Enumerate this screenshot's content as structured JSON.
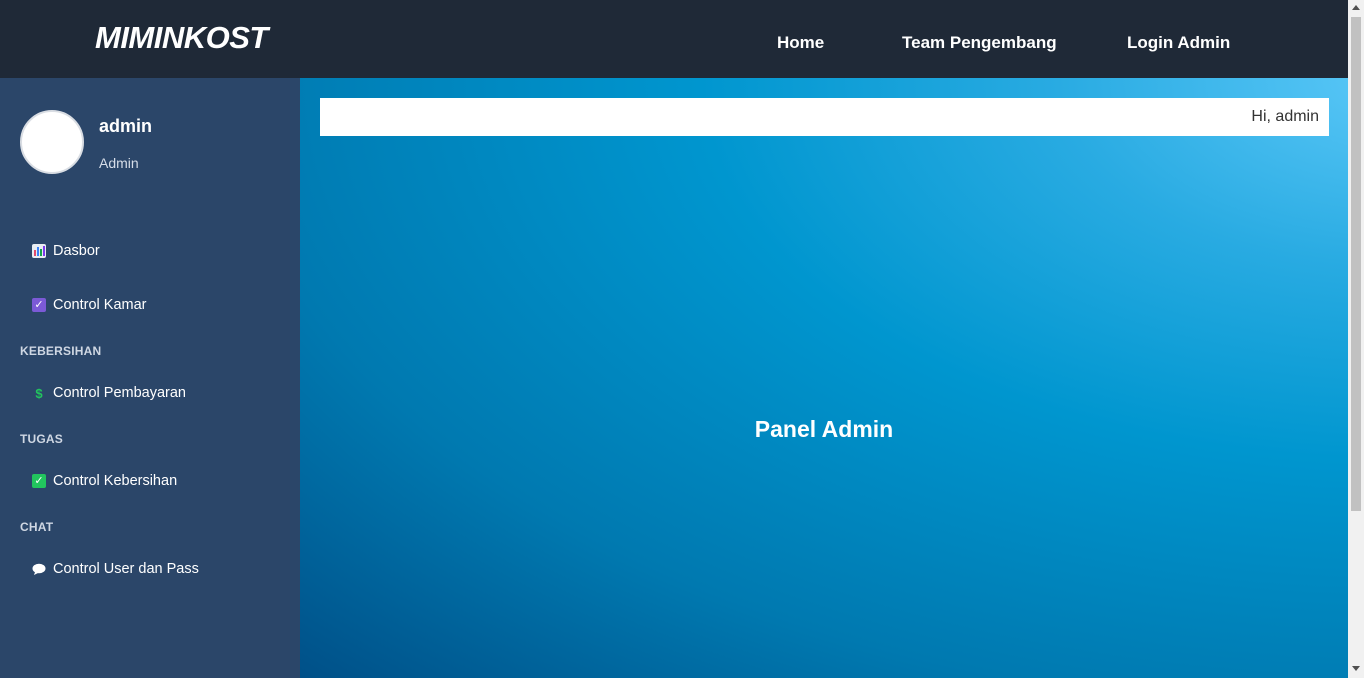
{
  "navbar": {
    "brand": "MIMINKOST",
    "links": [
      "Home",
      "Team Pengembang",
      "Login Admin"
    ]
  },
  "sidebar": {
    "user": {
      "name": "admin",
      "role": "Admin"
    },
    "items": [
      {
        "label": "Dasbor",
        "icon": "bar-chart-icon"
      },
      {
        "label": "Control Kamar",
        "icon": "checkbox-icon"
      },
      {
        "label": "Control Pembayaran",
        "icon": "dollar-icon"
      },
      {
        "label": "Control Kebersihan",
        "icon": "check-mark-icon"
      },
      {
        "label": "Control User dan Pass",
        "icon": "speech-bubble-icon"
      }
    ],
    "sections": [
      "KEBERSIHAN",
      "TUGAS",
      "CHAT"
    ]
  },
  "main": {
    "greeting": "Hi, admin",
    "title": "Panel Admin"
  },
  "colors": {
    "navbar_bg": "#1f2937",
    "sidebar_bg": "#2b4669",
    "main_gradient_light": "#5bc8f8",
    "main_gradient_dark": "#005088"
  }
}
